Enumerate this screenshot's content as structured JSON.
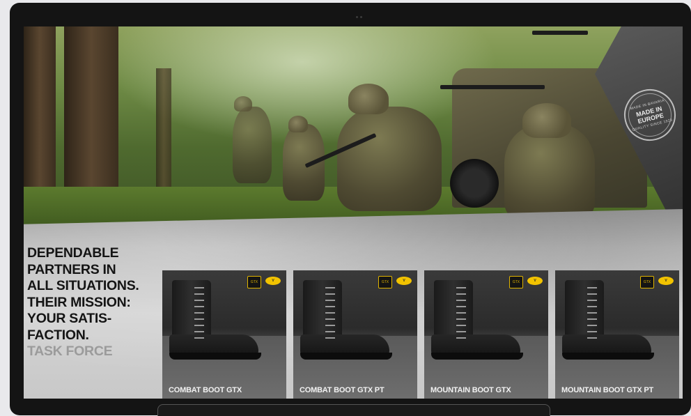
{
  "hero": {
    "badge": {
      "top_text": "MADE IN BAVARIA",
      "main_text": "MADE IN EUROPE",
      "bottom_text": "QUALITY SINCE 1923"
    }
  },
  "headline": {
    "lines": [
      "DEPENDABLE",
      "PARTNERS IN",
      "ALL SITUATIONS.",
      "THEIR MISSION:",
      "YOUR SATIS-",
      "FACTION.",
      "TASK FORCE"
    ]
  },
  "products": [
    {
      "name": "COMBAT BOOT GTX",
      "logos": [
        "gore-tex-icon",
        "vibram-icon"
      ]
    },
    {
      "name": "COMBAT BOOT GTX PT",
      "logos": [
        "gore-tex-icon",
        "vibram-icon"
      ]
    },
    {
      "name": "MOUNTAIN BOOT GTX",
      "logos": [
        "gore-tex-icon",
        "vibram-icon"
      ]
    },
    {
      "name": "MOUNTAIN BOOT GTX PT",
      "logos": [
        "gore-tex-icon",
        "vibram-icon"
      ]
    }
  ],
  "colors": {
    "device_frame": "#141414",
    "headline_text": "#141414",
    "product_card": "#2a2a2a",
    "gore_tex_accent": "#e0b400",
    "vibram_yellow": "#f2c300"
  }
}
